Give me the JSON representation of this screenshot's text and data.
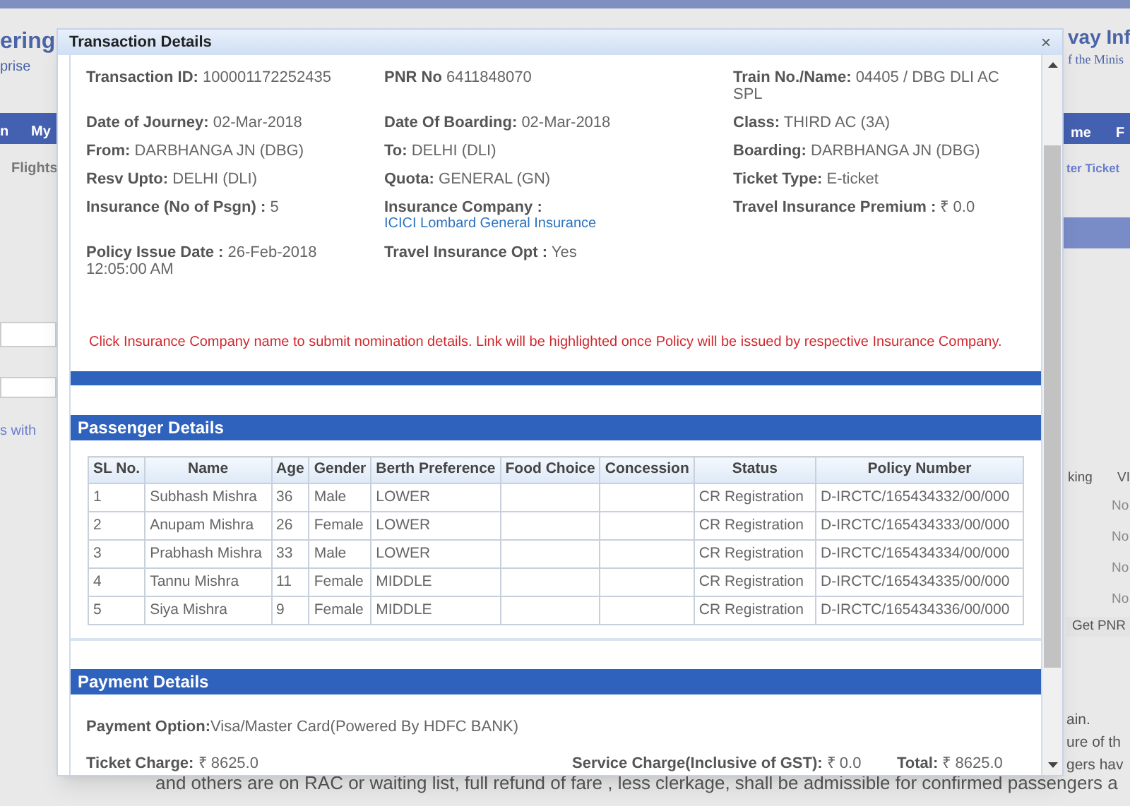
{
  "background": {
    "left_texts": [
      "ering",
      "prise",
      "n",
      "My",
      "Flights",
      "s with"
    ],
    "right_texts": [
      "vay Inf",
      "f the Minis",
      "me",
      "F",
      "ter Ticket",
      "king",
      "VI"
    ],
    "right_cells": [
      "No",
      "No",
      "No",
      "No"
    ],
    "right_button": "Get PNR",
    "notice_fragments": [
      "ain.",
      "ure of th",
      "gers hav"
    ],
    "notice_lines": [
      "and others are on RAC or waiting list, full refund of fare , less clerkage, shall be admissible for confirmed passengers a"
    ]
  },
  "modal": {
    "title": "Transaction Details",
    "close": "×",
    "fields": [
      {
        "label": "Transaction ID:",
        "value": "100001172252435"
      },
      {
        "label": "PNR No",
        "value": "6411848070"
      },
      {
        "label": "Train No./Name:",
        "value": "04405 /  DBG DLI AC SPL"
      },
      {
        "label": "Date of Journey:",
        "value": "02-Mar-2018"
      },
      {
        "label": "Date Of Boarding:",
        "value": "02-Mar-2018"
      },
      {
        "label": "Class:",
        "value": "THIRD AC (3A)"
      },
      {
        "label": "From:",
        "value": "DARBHANGA JN (DBG)"
      },
      {
        "label": "To:",
        "value": "DELHI (DLI)"
      },
      {
        "label": "Boarding:",
        "value": "DARBHANGA JN (DBG)"
      },
      {
        "label": "Resv Upto:",
        "value": "DELHI (DLI)"
      },
      {
        "label": "Quota:",
        "value": "GENERAL (GN)"
      },
      {
        "label": "Ticket Type:",
        "value": "E-ticket"
      },
      {
        "label": "Insurance (No of Psgn) :",
        "value": "5"
      },
      {
        "label": "Insurance Company :",
        "value": "ICICI Lombard General Insurance",
        "kind": "link"
      },
      {
        "label": "Travel Insurance Premium :",
        "value": "₹ 0.0"
      },
      {
        "label": "Policy Issue Date :",
        "value": "26-Feb-2018 12:05:00 AM"
      },
      {
        "label": "Travel Insurance Opt :",
        "value": "Yes"
      }
    ],
    "note": "Click Insurance Company name to submit nomination details. Link will be highlighted once Policy will be issued by respective Insurance Company.",
    "passenger_section": {
      "title": "Passenger Details",
      "columns": [
        "SL No.",
        "Name",
        "Age",
        "Gender",
        "Berth Preference",
        "Food Choice",
        "Concession",
        "Status",
        "Policy Number"
      ],
      "rows": [
        [
          "1",
          "Subhash Mishra",
          "36",
          "Male",
          "LOWER",
          "",
          "",
          "CR Registration",
          "D-IRCTC/165434332/00/000"
        ],
        [
          "2",
          "Anupam Mishra",
          "26",
          "Female",
          "LOWER",
          "",
          "",
          "CR Registration",
          "D-IRCTC/165434333/00/000"
        ],
        [
          "3",
          "Prabhash Mishra",
          "33",
          "Male",
          "LOWER",
          "",
          "",
          "CR Registration",
          "D-IRCTC/165434334/00/000"
        ],
        [
          "4",
          "Tannu Mishra",
          "11",
          "Female",
          "MIDDLE",
          "",
          "",
          "CR Registration",
          "D-IRCTC/165434335/00/000"
        ],
        [
          "5",
          "Siya Mishra",
          "9",
          "Female",
          "MIDDLE",
          "",
          "",
          "CR Registration",
          "D-IRCTC/165434336/00/000"
        ]
      ]
    },
    "payment_section": {
      "title": "Payment Details",
      "option": {
        "label": "Payment Option:",
        "value": "Visa/Master Card(Powered By HDFC BANK)"
      },
      "charges": [
        {
          "label": "Ticket Charge:",
          "value": "₹ 8625.0"
        },
        {
          "label": "Service Charge(Inclusive of GST):",
          "value": "₹ 0.0"
        },
        {
          "label": "Total:",
          "value": "₹ 8625.0"
        }
      ]
    }
  }
}
